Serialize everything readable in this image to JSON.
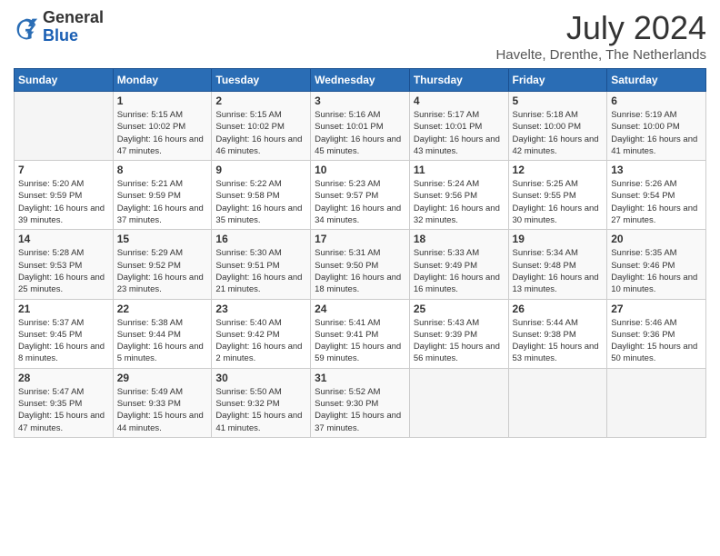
{
  "header": {
    "logo_general": "General",
    "logo_blue": "Blue",
    "month_title": "July 2024",
    "subtitle": "Havelte, Drenthe, The Netherlands"
  },
  "calendar": {
    "days_of_week": [
      "Sunday",
      "Monday",
      "Tuesday",
      "Wednesday",
      "Thursday",
      "Friday",
      "Saturday"
    ],
    "weeks": [
      [
        {
          "day": "",
          "info": ""
        },
        {
          "day": "1",
          "info": "Sunrise: 5:15 AM\nSunset: 10:02 PM\nDaylight: 16 hours\nand 47 minutes."
        },
        {
          "day": "2",
          "info": "Sunrise: 5:15 AM\nSunset: 10:02 PM\nDaylight: 16 hours\nand 46 minutes."
        },
        {
          "day": "3",
          "info": "Sunrise: 5:16 AM\nSunset: 10:01 PM\nDaylight: 16 hours\nand 45 minutes."
        },
        {
          "day": "4",
          "info": "Sunrise: 5:17 AM\nSunset: 10:01 PM\nDaylight: 16 hours\nand 43 minutes."
        },
        {
          "day": "5",
          "info": "Sunrise: 5:18 AM\nSunset: 10:00 PM\nDaylight: 16 hours\nand 42 minutes."
        },
        {
          "day": "6",
          "info": "Sunrise: 5:19 AM\nSunset: 10:00 PM\nDaylight: 16 hours\nand 41 minutes."
        }
      ],
      [
        {
          "day": "7",
          "info": "Sunrise: 5:20 AM\nSunset: 9:59 PM\nDaylight: 16 hours\nand 39 minutes."
        },
        {
          "day": "8",
          "info": "Sunrise: 5:21 AM\nSunset: 9:59 PM\nDaylight: 16 hours\nand 37 minutes."
        },
        {
          "day": "9",
          "info": "Sunrise: 5:22 AM\nSunset: 9:58 PM\nDaylight: 16 hours\nand 35 minutes."
        },
        {
          "day": "10",
          "info": "Sunrise: 5:23 AM\nSunset: 9:57 PM\nDaylight: 16 hours\nand 34 minutes."
        },
        {
          "day": "11",
          "info": "Sunrise: 5:24 AM\nSunset: 9:56 PM\nDaylight: 16 hours\nand 32 minutes."
        },
        {
          "day": "12",
          "info": "Sunrise: 5:25 AM\nSunset: 9:55 PM\nDaylight: 16 hours\nand 30 minutes."
        },
        {
          "day": "13",
          "info": "Sunrise: 5:26 AM\nSunset: 9:54 PM\nDaylight: 16 hours\nand 27 minutes."
        }
      ],
      [
        {
          "day": "14",
          "info": "Sunrise: 5:28 AM\nSunset: 9:53 PM\nDaylight: 16 hours\nand 25 minutes."
        },
        {
          "day": "15",
          "info": "Sunrise: 5:29 AM\nSunset: 9:52 PM\nDaylight: 16 hours\nand 23 minutes."
        },
        {
          "day": "16",
          "info": "Sunrise: 5:30 AM\nSunset: 9:51 PM\nDaylight: 16 hours\nand 21 minutes."
        },
        {
          "day": "17",
          "info": "Sunrise: 5:31 AM\nSunset: 9:50 PM\nDaylight: 16 hours\nand 18 minutes."
        },
        {
          "day": "18",
          "info": "Sunrise: 5:33 AM\nSunset: 9:49 PM\nDaylight: 16 hours\nand 16 minutes."
        },
        {
          "day": "19",
          "info": "Sunrise: 5:34 AM\nSunset: 9:48 PM\nDaylight: 16 hours\nand 13 minutes."
        },
        {
          "day": "20",
          "info": "Sunrise: 5:35 AM\nSunset: 9:46 PM\nDaylight: 16 hours\nand 10 minutes."
        }
      ],
      [
        {
          "day": "21",
          "info": "Sunrise: 5:37 AM\nSunset: 9:45 PM\nDaylight: 16 hours\nand 8 minutes."
        },
        {
          "day": "22",
          "info": "Sunrise: 5:38 AM\nSunset: 9:44 PM\nDaylight: 16 hours\nand 5 minutes."
        },
        {
          "day": "23",
          "info": "Sunrise: 5:40 AM\nSunset: 9:42 PM\nDaylight: 16 hours\nand 2 minutes."
        },
        {
          "day": "24",
          "info": "Sunrise: 5:41 AM\nSunset: 9:41 PM\nDaylight: 15 hours\nand 59 minutes."
        },
        {
          "day": "25",
          "info": "Sunrise: 5:43 AM\nSunset: 9:39 PM\nDaylight: 15 hours\nand 56 minutes."
        },
        {
          "day": "26",
          "info": "Sunrise: 5:44 AM\nSunset: 9:38 PM\nDaylight: 15 hours\nand 53 minutes."
        },
        {
          "day": "27",
          "info": "Sunrise: 5:46 AM\nSunset: 9:36 PM\nDaylight: 15 hours\nand 50 minutes."
        }
      ],
      [
        {
          "day": "28",
          "info": "Sunrise: 5:47 AM\nSunset: 9:35 PM\nDaylight: 15 hours\nand 47 minutes."
        },
        {
          "day": "29",
          "info": "Sunrise: 5:49 AM\nSunset: 9:33 PM\nDaylight: 15 hours\nand 44 minutes."
        },
        {
          "day": "30",
          "info": "Sunrise: 5:50 AM\nSunset: 9:32 PM\nDaylight: 15 hours\nand 41 minutes."
        },
        {
          "day": "31",
          "info": "Sunrise: 5:52 AM\nSunset: 9:30 PM\nDaylight: 15 hours\nand 37 minutes."
        },
        {
          "day": "",
          "info": ""
        },
        {
          "day": "",
          "info": ""
        },
        {
          "day": "",
          "info": ""
        }
      ]
    ]
  }
}
